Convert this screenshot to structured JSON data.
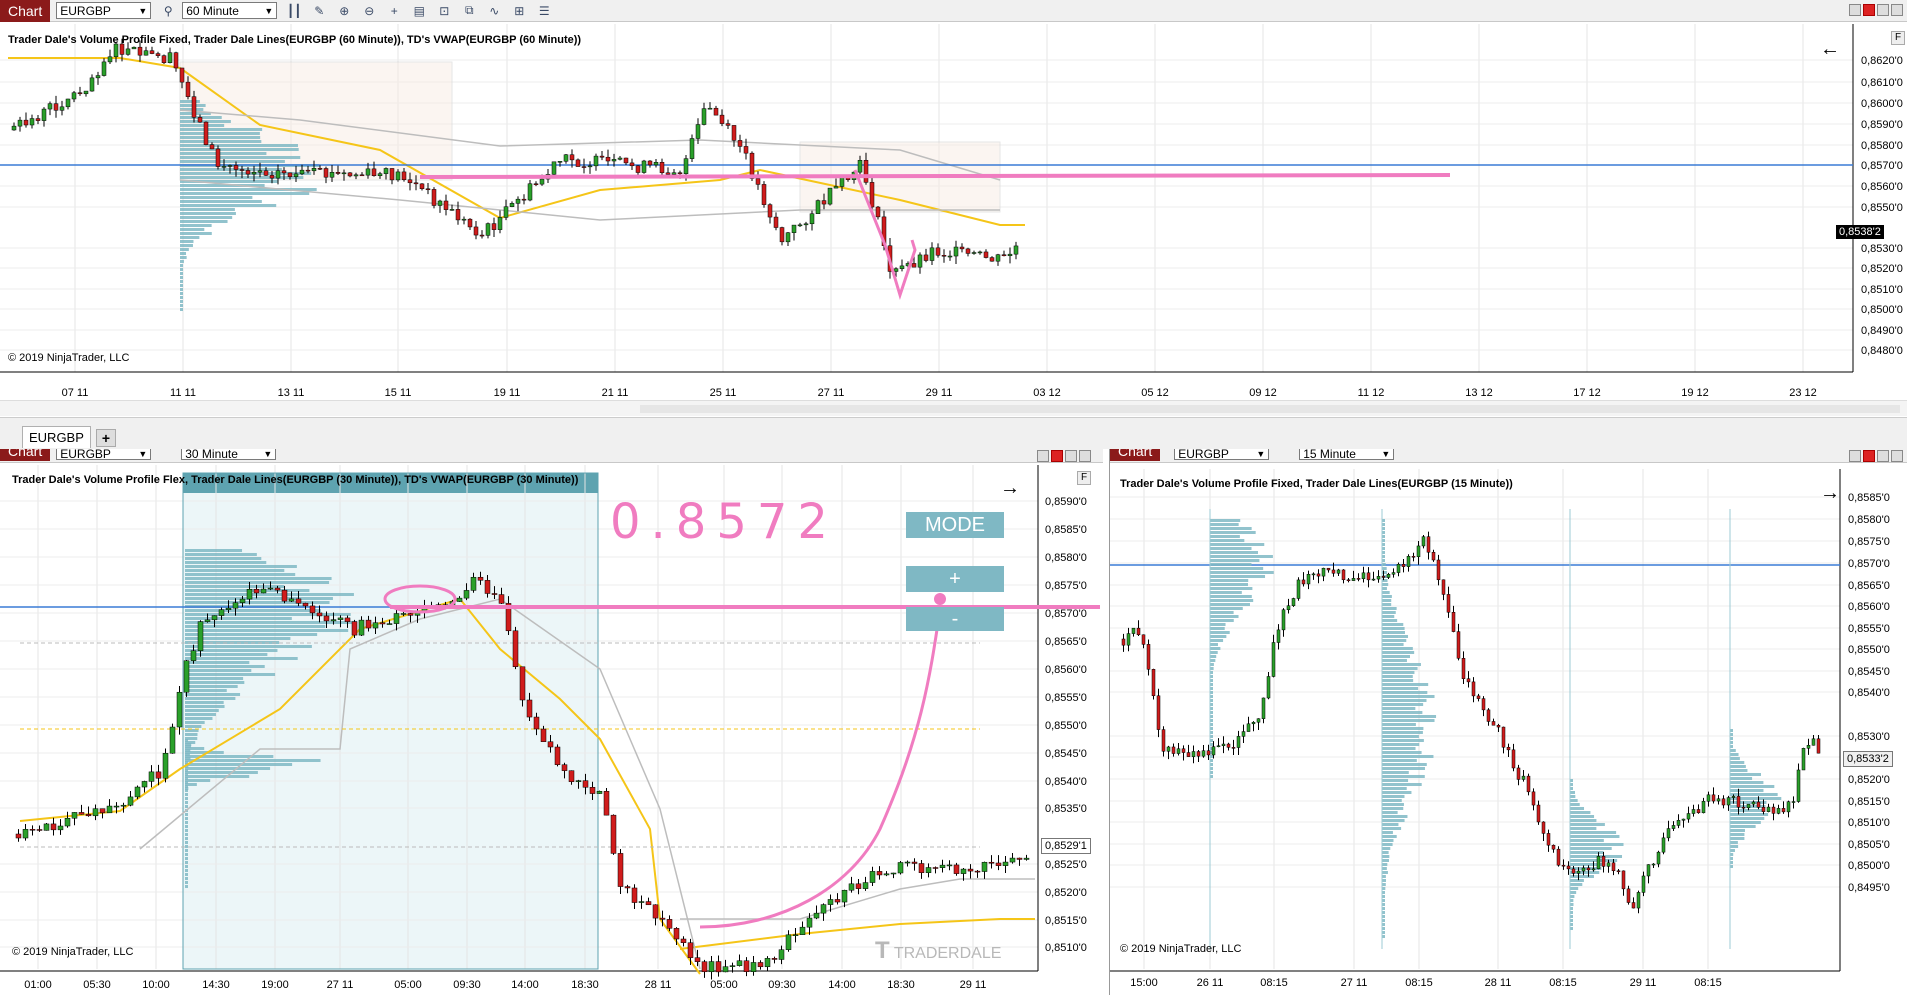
{
  "top_chart": {
    "tab_label": "Chart",
    "instrument": "EURGBP",
    "interval": "60 Minute",
    "indicator_title": "Trader Dale's Volume Profile Fixed, Trader Dale Lines(EURGBP (60 Minute)), TD's VWAP(EURGBP (60 Minute))",
    "copyright": "© 2019 NinjaTrader, LLC",
    "current_price": "0,8538'2",
    "price_ticks": [
      "0,8620'0",
      "0,8610'0",
      "0,8600'0",
      "0,8590'0",
      "0,8580'0",
      "0,8570'0",
      "0,8560'0",
      "0,8550'0",
      "0,8530'0",
      "0,8520'0",
      "0,8510'0",
      "0,8500'0",
      "0,8490'0",
      "0,8480'0"
    ],
    "time_ticks": [
      "07 11",
      "11 11",
      "13 11",
      "15 11",
      "19 11",
      "21 11",
      "25 11",
      "27 11",
      "29 11",
      "03 12",
      "05 12",
      "09 12",
      "11 12",
      "13 12",
      "17 12",
      "19 12",
      "23 12"
    ],
    "f_label": "F",
    "back_arrow": "←"
  },
  "tabs_bar": {
    "tab": "EURGBP",
    "add": "+"
  },
  "bottom_left_chart": {
    "tab_label": "Chart",
    "instrument": "EURGBP",
    "interval": "30 Minute",
    "indicator_title": "Trader Dale's Volume Profile Flex, Trader Dale Lines(EURGBP (30 Minute)), TD's VWAP(EURGBP (30 Minute))",
    "copyright": "© 2019 NinjaTrader, LLC",
    "current_price": "0,8529'1",
    "handwritten_note": "0.8572",
    "mode_button": "MODE",
    "plus_button": "+",
    "minus_button": "-",
    "watermark": "TRADERDALE",
    "price_ticks": [
      "0,8590'0",
      "0,8585'0",
      "0,8580'0",
      "0,8575'0",
      "0,8570'0",
      "0,8565'0",
      "0,8560'0",
      "0,8555'0",
      "0,8550'0",
      "0,8545'0",
      "0,8540'0",
      "0,8535'0",
      "0,8525'0",
      "0,8520'0",
      "0,8515'0",
      "0,8510'0"
    ],
    "time_ticks": [
      "01:00",
      "05:30",
      "10:00",
      "14:30",
      "19:00",
      "27 11",
      "05:00",
      "09:30",
      "14:00",
      "18:30",
      "28 11",
      "05:00",
      "09:30",
      "14:00",
      "18:30",
      "29 11"
    ],
    "f_label": "F",
    "forward_arrow": "→"
  },
  "bottom_right_chart": {
    "tab_label": "Chart",
    "instrument": "EURGBP",
    "interval": "15 Minute",
    "indicator_title": "Trader Dale's Volume Profile Fixed, Trader Dale Lines(EURGBP (15 Minute))",
    "copyright": "© 2019 NinjaTrader, LLC",
    "current_price": "0,8533'2",
    "price_ticks": [
      "0,8585'0",
      "0,8580'0",
      "0,8575'0",
      "0,8570'0",
      "0,8565'0",
      "0,8560'0",
      "0,8555'0",
      "0,8550'0",
      "0,8545'0",
      "0,8540'0",
      "0,8530'0",
      "0,8525'0",
      "0,8520'0",
      "0,8515'0",
      "0,8510'0",
      "0,8505'0",
      "0,8500'0",
      "0,8495'0"
    ],
    "time_ticks": [
      "15:00",
      "26 11",
      "08:15",
      "27 11",
      "08:15",
      "28 11",
      "08:15",
      "29 11",
      "08:15"
    ],
    "forward_arrow": "→"
  },
  "colors": {
    "bull_candle": "#2aa02a",
    "bear_candle": "#d01c1c",
    "vwap": "#f5c518",
    "value_area": "#bdbdbd",
    "volume_profile": "#7fb8c4",
    "level_line": "#3a7bd5",
    "annotation": "#f07cc0"
  }
}
